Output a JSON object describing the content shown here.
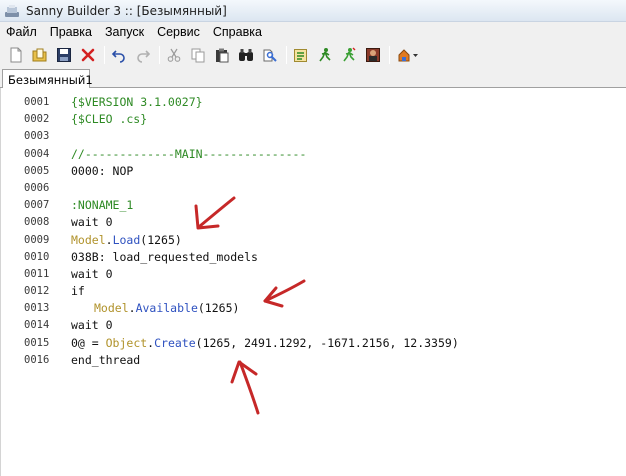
{
  "window": {
    "title": "Sanny Builder 3 :: [Безымянный]"
  },
  "menu": {
    "items": [
      "Файл",
      "Правка",
      "Запуск",
      "Сервис",
      "Справка"
    ]
  },
  "toolbar": {
    "icons": [
      "new-file-icon",
      "open-folder-icon",
      "save-icon",
      "close-icon",
      "undo-icon",
      "redo-icon",
      "cut-icon",
      "copy-icon",
      "paste-icon",
      "find-icon",
      "replace-icon",
      "compile-icon",
      "compile-run-icon",
      "run-icon",
      "game-icon",
      "tools-dropdown-icon"
    ]
  },
  "tabs": [
    {
      "label": "Безымянный1"
    }
  ],
  "editor": {
    "lines": [
      {
        "num": "0001",
        "text": "{$VERSION 3.1.0027}"
      },
      {
        "num": "0002",
        "text": "{$CLEO .cs}"
      },
      {
        "num": "0003",
        "text": ""
      },
      {
        "num": "0004",
        "text": "//-------------MAIN---------------"
      },
      {
        "num": "0005",
        "text": "0000: NOP"
      },
      {
        "num": "0006",
        "text": ""
      },
      {
        "num": "0007",
        "text": ":NONAME_1"
      },
      {
        "num": "0008",
        "text": "wait 0"
      },
      {
        "num": "0009",
        "cls": "Model",
        "dot": ".",
        "meth": "Load",
        "args": "(1265)"
      },
      {
        "num": "0010",
        "text": "038B: load_requested_models"
      },
      {
        "num": "0011",
        "text": "wait 0"
      },
      {
        "num": "0012",
        "text": "if"
      },
      {
        "num": "0013",
        "cls": "Model",
        "dot": ".",
        "meth": "Available",
        "args": "(1265)"
      },
      {
        "num": "0014",
        "text": "wait 0"
      },
      {
        "num": "0015",
        "pre": "0@ = ",
        "cls": "Object",
        "dot": ".",
        "meth": "Create",
        "args": "(1265, 2491.1292, -1671.2156, 12.3359)"
      },
      {
        "num": "0016",
        "text": "end_thread"
      }
    ]
  },
  "colors": {
    "directive": "#2e8a24",
    "class": "#b0922a",
    "method": "#2f52c0",
    "annotation": "#c62828"
  }
}
